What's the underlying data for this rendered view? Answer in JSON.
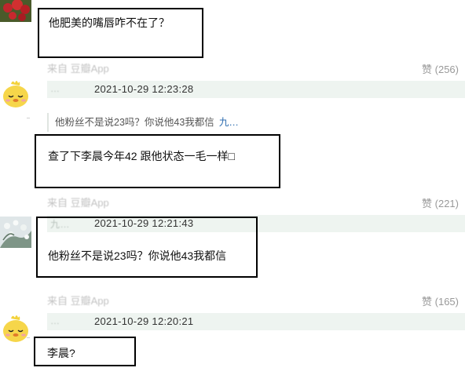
{
  "comments": [
    {
      "content": "他肥美的嘴唇咋不在了？",
      "source": "来自 豆瓣App",
      "likes": "赞 (256)"
    },
    {
      "username": "…",
      "timestamp": "2021-10-29 12:23:28",
      "quote_text": "他粉丝不是说23吗？你说他43我都信",
      "quote_author": "九…",
      "content": "查了下李晨今年42 跟他状态一毛一样□",
      "source": "来自 豆瓣App",
      "likes": "赞 (221)"
    },
    {
      "username": "九…",
      "timestamp": "2021-10-29 12:21:43",
      "content": "他粉丝不是说23吗？你说他43我都信",
      "source": "来自 豆瓣App",
      "likes": "赞 (165)"
    },
    {
      "username": "…",
      "timestamp": "2021-10-29 12:20:21",
      "content": "李晨?"
    }
  ]
}
